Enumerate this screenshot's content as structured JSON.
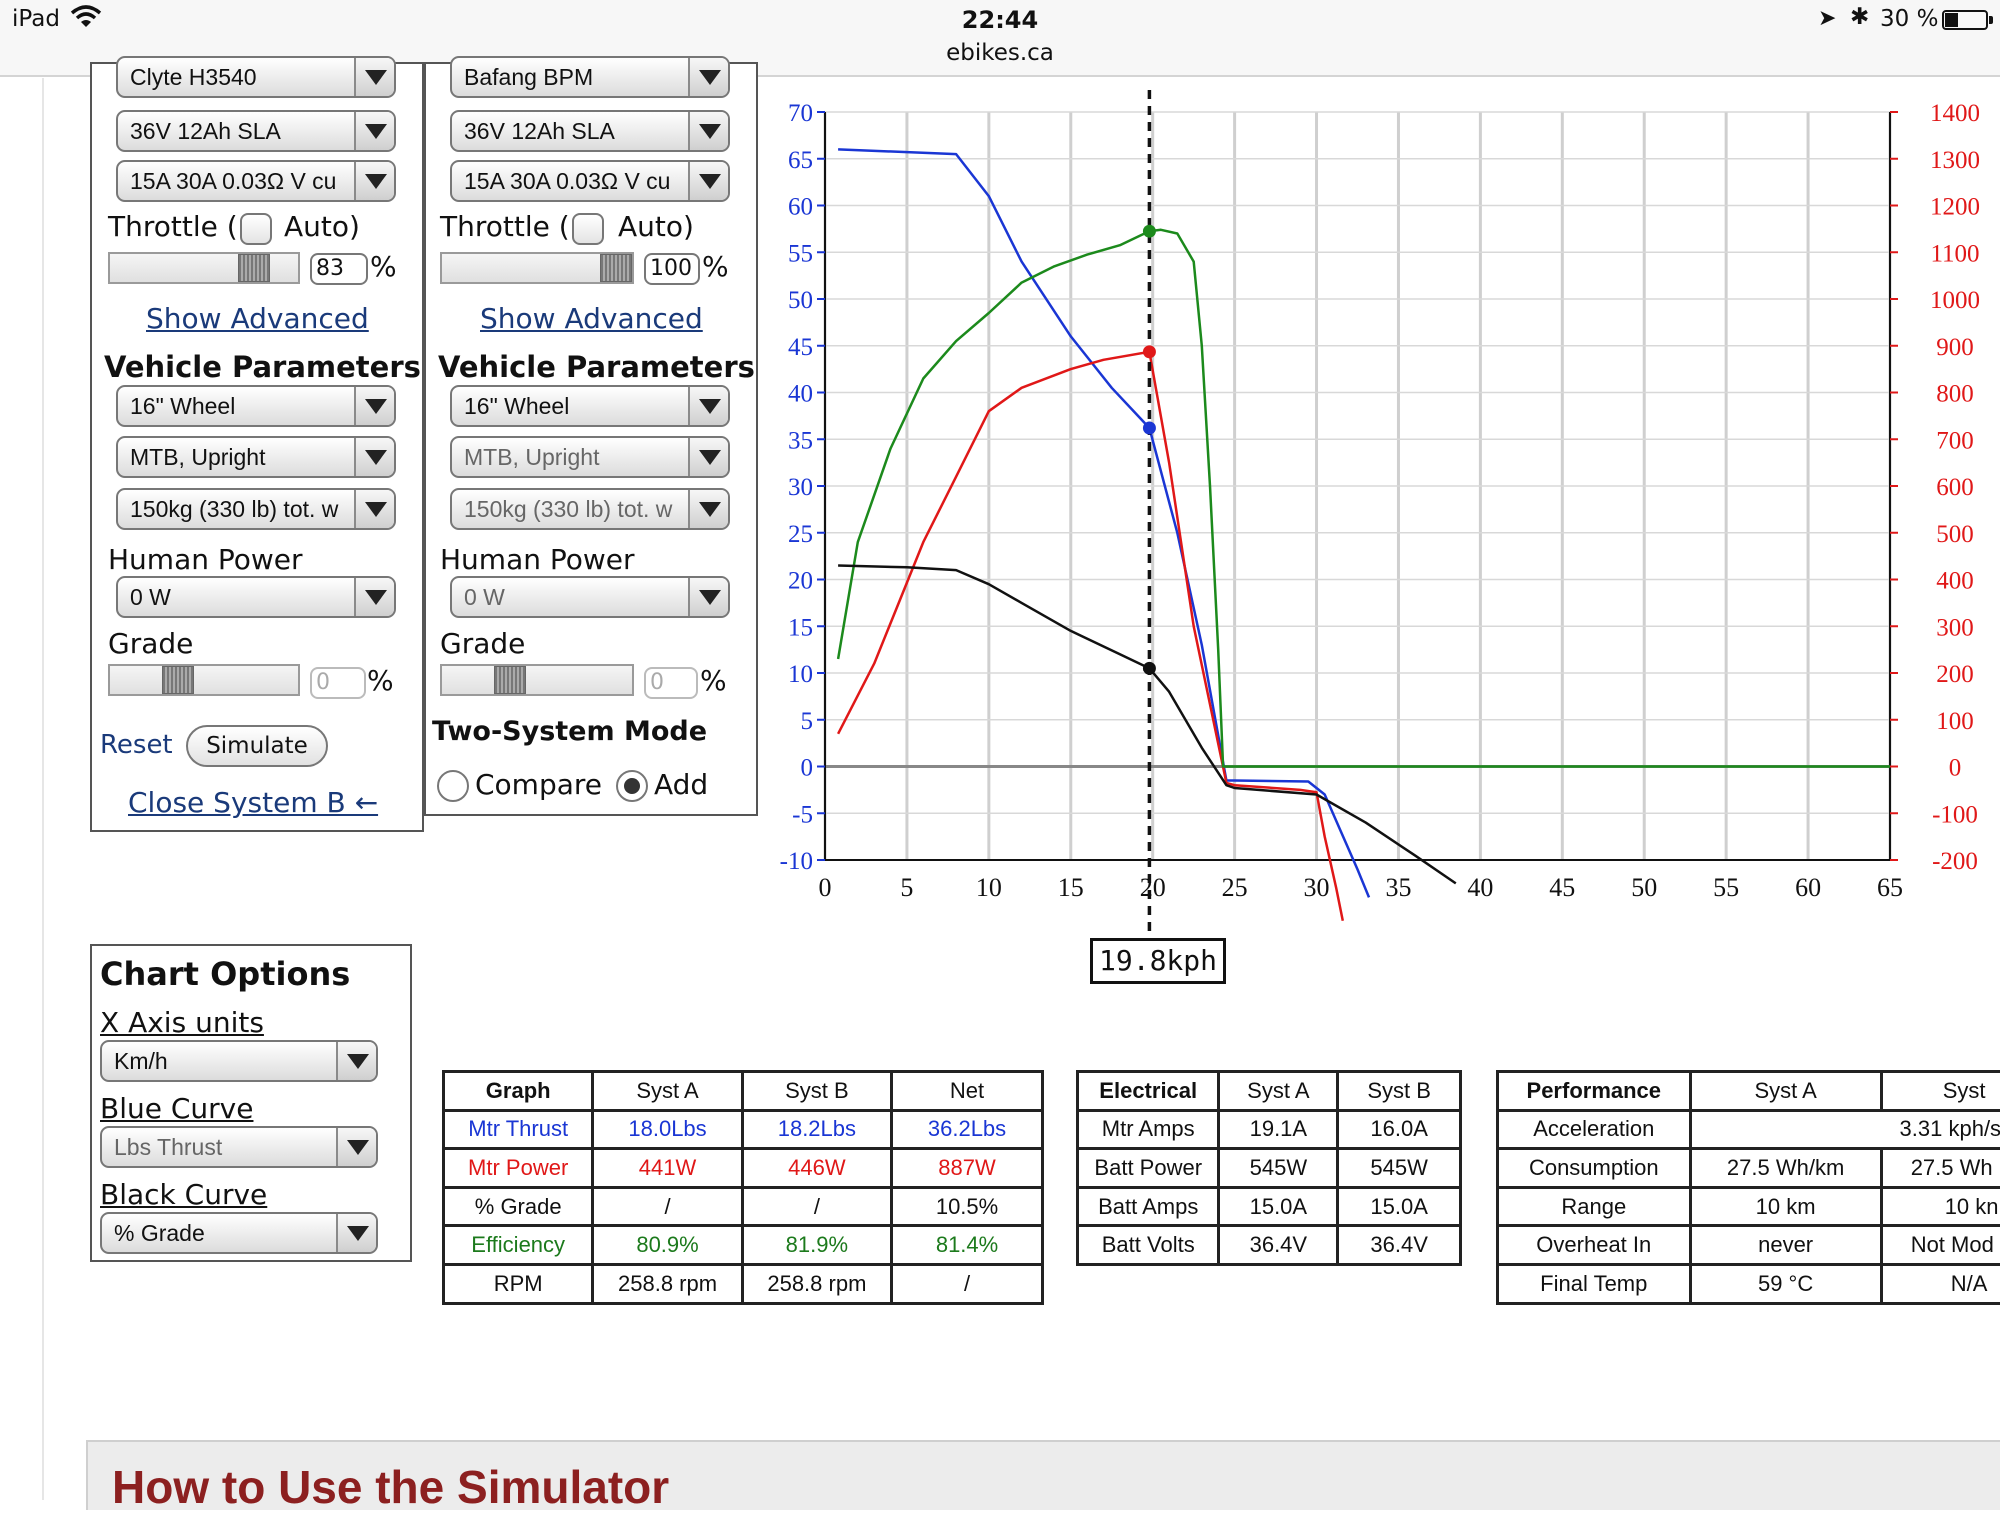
{
  "status_bar": {
    "device": "iPad",
    "time": "22:44",
    "url": "ebikes.ca",
    "battery": "30 %"
  },
  "system_a": {
    "motor_select": "Clyte H3540",
    "battery_select": "36V 12Ah SLA",
    "controller_select": "15A 30A 0.03Ω V cu",
    "throttle_label": "Throttle (",
    "auto_label": "Auto)",
    "throttle_value": "83",
    "show_advanced": "Show Advanced",
    "vehicle_heading": "Vehicle Parameters",
    "wheel_select": "16\"  Wheel",
    "posture_select": "MTB, Upright",
    "weight_select": "150kg (330 lb) tot. w",
    "human_power_label": "Human Power",
    "human_power_select": "0 W",
    "grade_label": "Grade",
    "grade_value": "0",
    "reset_link": "Reset",
    "simulate_button": "Simulate",
    "close_link": "Close System B ←"
  },
  "system_b": {
    "motor_select": "Bafang BPM",
    "battery_select": "36V 12Ah SLA",
    "controller_select": "15A 30A 0.03Ω V cu",
    "throttle_label": "Throttle (",
    "auto_label": "Auto)",
    "throttle_value": "100",
    "show_advanced": "Show Advanced",
    "vehicle_heading": "Vehicle Parameters",
    "wheel_select": "16\"  Wheel",
    "posture_select": "MTB, Upright",
    "weight_select": "150kg (330 lb) tot. w",
    "human_power_label": "Human Power",
    "human_power_select": "0 W",
    "grade_label": "Grade",
    "grade_value": "0",
    "two_system_heading": "Two-System Mode",
    "compare_label": "Compare",
    "add_label": "Add",
    "mode_selected": "Add"
  },
  "percent_sign": "%",
  "chart_options": {
    "heading": "Chart Options",
    "x_axis_label": "X Axis units",
    "x_axis_select": "Km/h",
    "blue_curve_label": "Blue Curve",
    "blue_curve_select": "Lbs Thrust",
    "black_curve_label": "Black Curve",
    "black_curve_select": "% Grade"
  },
  "chart_data": {
    "type": "line",
    "xlim": [
      0,
      65
    ],
    "x_ticks": [
      "0",
      "5",
      "10",
      "15",
      "20",
      "25",
      "30",
      "35",
      "40",
      "45",
      "50",
      "55",
      "60",
      "65"
    ],
    "ylim_left": [
      -10,
      70
    ],
    "y_left_ticks": [
      "-10",
      "-5",
      "0",
      "5",
      "10",
      "15",
      "20",
      "25",
      "30",
      "35",
      "40",
      "45",
      "50",
      "55",
      "60",
      "65",
      "70"
    ],
    "ylim_right": [
      -200,
      1400
    ],
    "y_right_ticks": [
      "-200",
      "-100",
      "0",
      "100",
      "200",
      "300",
      "400",
      "500",
      "600",
      "700",
      "800",
      "900",
      "1000",
      "1100",
      "1200",
      "1300",
      "1400"
    ],
    "grid": true,
    "cursor_x": 19.8,
    "cursor_label": "19.8kph",
    "series": [
      {
        "color": "#1a36d4",
        "axis": "left",
        "points": [
          [
            0.8,
            66
          ],
          [
            8,
            65.5
          ],
          [
            10,
            61
          ],
          [
            12,
            54
          ],
          [
            15,
            46
          ],
          [
            17.5,
            40.5
          ],
          [
            19.8,
            36.2
          ],
          [
            21.5,
            25
          ],
          [
            23,
            13
          ],
          [
            24.5,
            -1.5
          ],
          [
            25,
            -1.5
          ],
          [
            29.5,
            -1.6
          ],
          [
            30.5,
            -3
          ],
          [
            31.5,
            -7
          ],
          [
            32.5,
            -11
          ],
          [
            33.2,
            -14
          ]
        ]
      },
      {
        "color": "#e01818",
        "axis": "right",
        "points": [
          [
            0.8,
            70
          ],
          [
            3,
            220
          ],
          [
            6,
            480
          ],
          [
            8,
            620
          ],
          [
            10,
            760
          ],
          [
            12,
            810
          ],
          [
            15,
            850
          ],
          [
            17,
            870
          ],
          [
            19.8,
            887
          ],
          [
            21,
            650
          ],
          [
            22.5,
            300
          ],
          [
            24.5,
            -35
          ],
          [
            25,
            -40
          ],
          [
            29,
            -50
          ],
          [
            30,
            -55
          ],
          [
            30.5,
            -150
          ],
          [
            31.2,
            -260
          ],
          [
            31.6,
            -330
          ]
        ]
      },
      {
        "color": "#1c8a1c",
        "axis": "right",
        "points": [
          [
            0.8,
            230
          ],
          [
            2,
            480
          ],
          [
            4,
            680
          ],
          [
            6,
            830
          ],
          [
            8,
            910
          ],
          [
            10,
            970
          ],
          [
            12,
            1035
          ],
          [
            14,
            1070
          ],
          [
            16,
            1095
          ],
          [
            18,
            1115
          ],
          [
            19.8,
            1145
          ],
          [
            20.5,
            1148
          ],
          [
            21.5,
            1140
          ],
          [
            22.5,
            1080
          ],
          [
            23,
            900
          ],
          [
            23.5,
            600
          ],
          [
            24,
            250
          ],
          [
            24.3,
            0
          ],
          [
            65,
            0
          ]
        ]
      },
      {
        "color": "#111111",
        "axis": "left",
        "points": [
          [
            0.8,
            21.5
          ],
          [
            5,
            21.3
          ],
          [
            8,
            21
          ],
          [
            10,
            19.5
          ],
          [
            12,
            17.5
          ],
          [
            15,
            14.5
          ],
          [
            18,
            12
          ],
          [
            19.8,
            10.5
          ],
          [
            21,
            8
          ],
          [
            23,
            2
          ],
          [
            24.5,
            -2
          ],
          [
            25,
            -2.3
          ],
          [
            30,
            -3
          ],
          [
            33,
            -6
          ],
          [
            36,
            -9.5
          ],
          [
            38.5,
            -12.5
          ]
        ]
      }
    ],
    "cursor_dots": [
      {
        "x": 19.8,
        "y": 36.2,
        "axis": "left",
        "color": "#1a36d4"
      },
      {
        "x": 19.8,
        "y": 887,
        "axis": "right",
        "color": "#e01818"
      },
      {
        "x": 19.8,
        "y": 1145,
        "axis": "right",
        "color": "#1c8a1c"
      },
      {
        "x": 19.8,
        "y": 10.5,
        "axis": "left",
        "color": "#111111"
      }
    ]
  },
  "graph_table": {
    "headers": [
      "Graph",
      "Syst A",
      "Syst B",
      "Net"
    ],
    "rows": [
      {
        "cells": [
          "Mtr Thrust",
          "18.0Lbs",
          "18.2Lbs",
          "36.2Lbs"
        ],
        "color": "blue"
      },
      {
        "cells": [
          "Mtr Power",
          "441W",
          "446W",
          "887W"
        ],
        "color": "red"
      },
      {
        "cells": [
          "% Grade",
          "/",
          "/",
          "10.5%"
        ],
        "color": "black"
      },
      {
        "cells": [
          "Efficiency",
          "80.9%",
          "81.9%",
          "81.4%"
        ],
        "color": "green"
      },
      {
        "cells": [
          "RPM",
          "258.8 rpm",
          "258.8 rpm",
          "/"
        ],
        "color": "black"
      }
    ]
  },
  "electrical_table": {
    "headers": [
      "Electrical",
      "Syst A",
      "Syst B"
    ],
    "rows": [
      [
        "Mtr Amps",
        "19.1A",
        "16.0A"
      ],
      [
        "Batt Power",
        "545W",
        "545W"
      ],
      [
        "Batt Amps",
        "15.0A",
        "15.0A"
      ],
      [
        "Batt Volts",
        "36.4V",
        "36.4V"
      ]
    ]
  },
  "performance_table": {
    "headers": [
      "Performance",
      "Syst A",
      "Syst"
    ],
    "acceleration": [
      "Acceleration",
      "3.31 kph/s"
    ],
    "rows": [
      [
        "Consumption",
        "27.5 Wh/km",
        "27.5 Wh"
      ],
      [
        "Range",
        "10 km",
        "10 kn"
      ],
      [
        "Overheat In",
        "never",
        "Not Mod"
      ],
      [
        "Final Temp",
        "59 °C",
        "N/A"
      ]
    ]
  },
  "howto_heading": "How to Use the Simulator",
  "colors": {
    "blue": "#1a36d4",
    "red": "#e01818",
    "green": "#1c8a1c",
    "black": "#111111",
    "link": "#1a3a7a",
    "banner_text": "#8c2020"
  }
}
